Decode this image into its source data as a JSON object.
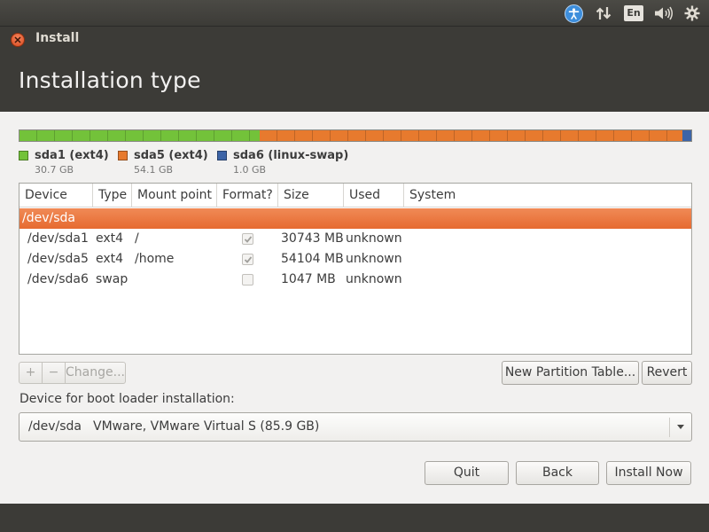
{
  "panel": {
    "icons": [
      "accessibility-icon",
      "network-icon",
      "keyboard-layout-icon",
      "sound-icon",
      "gear-icon"
    ],
    "keyboard_layout": "En"
  },
  "window": {
    "title": "Install"
  },
  "page": {
    "title": "Installation type"
  },
  "partition_bar": {
    "segments": [
      {
        "name": "sda1",
        "fraction": 0.357,
        "color": "#73c23a"
      },
      {
        "name": "sda5",
        "fraction": 0.63,
        "color": "#e77a2e"
      },
      {
        "name": "sda6",
        "fraction": 0.013,
        "color": "#3d64a7"
      }
    ]
  },
  "legend": [
    {
      "label": "sda1 (ext4)",
      "size": "30.7 GB",
      "color": "#73c23a"
    },
    {
      "label": "sda5 (ext4)",
      "size": "54.1 GB",
      "color": "#e77a2e"
    },
    {
      "label": "sda6 (linux-swap)",
      "size": "1.0 GB",
      "color": "#3d64a7"
    }
  ],
  "table": {
    "columns": [
      "Device",
      "Type",
      "Mount point",
      "Format?",
      "Size",
      "Used",
      "System"
    ],
    "selected_row": {
      "device": "/dev/sda"
    },
    "rows": [
      {
        "device": "/dev/sda1",
        "type": "ext4",
        "mount": "/",
        "format": true,
        "size": "30743 MB",
        "used": "unknown",
        "system": ""
      },
      {
        "device": "/dev/sda5",
        "type": "ext4",
        "mount": "/home",
        "format": true,
        "size": "54104 MB",
        "used": "unknown",
        "system": ""
      },
      {
        "device": "/dev/sda6",
        "type": "swap",
        "mount": "",
        "format": false,
        "size": "1047 MB",
        "used": "unknown",
        "system": ""
      }
    ]
  },
  "toolbar": {
    "add": "+",
    "remove": "−",
    "change": "Change...",
    "new_table": "New Partition Table...",
    "revert": "Revert"
  },
  "boot": {
    "label": "Device for boot loader installation:",
    "device": "/dev/sda",
    "description": "VMware, VMware Virtual S (85.9 GB)"
  },
  "actions": {
    "quit": "Quit",
    "back": "Back",
    "install": "Install Now"
  }
}
